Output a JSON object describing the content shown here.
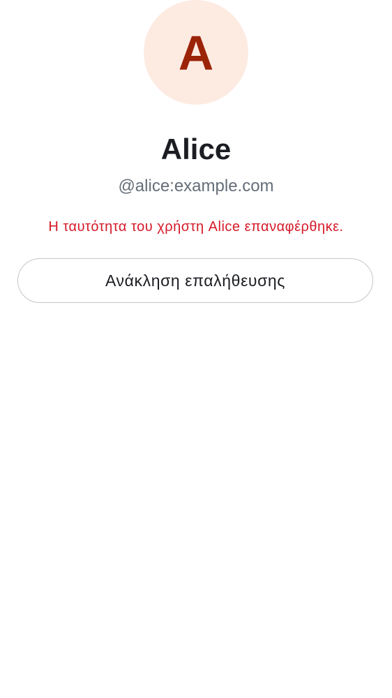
{
  "profile": {
    "avatar_initial": "A",
    "display_name": "Alice",
    "user_id": "@alice:example.com"
  },
  "status": {
    "message": "Η ταυτότητα του χρήστη Alice επαναφέρθηκε."
  },
  "actions": {
    "withdraw_verification_label": "Ανάκληση επαλήθευσης"
  },
  "colors": {
    "avatar_background": "#fdebe2",
    "avatar_letter": "#9b2308",
    "status_error": "#d51928",
    "text_primary": "#1b1d22",
    "text_secondary": "#656d77",
    "button_border": "#c4c6cb"
  }
}
